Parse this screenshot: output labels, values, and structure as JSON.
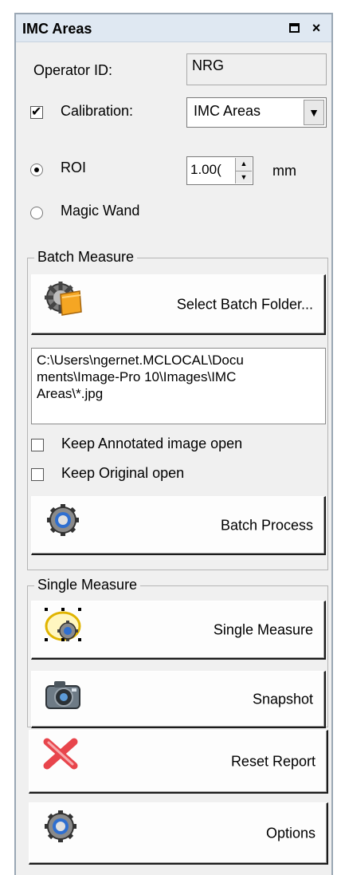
{
  "window": {
    "title": "IMC Areas",
    "maximize_icon": "maximize-icon",
    "close_glyph": "×"
  },
  "operator": {
    "label": "Operator ID:",
    "value": "NRG"
  },
  "calibration": {
    "label": "Calibration:",
    "checked": true,
    "value": "IMC Areas",
    "arrow": "▼"
  },
  "roi": {
    "label": "ROI",
    "selected": true,
    "value": "1.00(",
    "unit": "mm"
  },
  "magic_wand": {
    "label": "Magic Wand",
    "selected": false
  },
  "batch": {
    "group_label": "Batch Measure",
    "select_folder_label": "Select Batch Folder...",
    "path": "C:\\Users\\ngernet.MCLOCAL\\Docu\nments\\Image-Pro 10\\Images\\IMC\nAreas\\*.jpg",
    "keep_annotated_label": "Keep Annotated image open",
    "keep_original_label": "Keep Original open",
    "process_label": "Batch Process"
  },
  "single": {
    "group_label": "Single Measure",
    "measure_label": "Single Measure",
    "snapshot_label": "Snapshot"
  },
  "reset_label": "Reset Report",
  "options_label": "Options",
  "icons": {
    "folder_gear": "folder-gear-icon",
    "gear": "gear-icon",
    "roi_gear": "roi-gear-icon",
    "camera": "camera-icon",
    "red_x": "red-x-icon"
  },
  "colors": {
    "titlebar": "#dfe8f2",
    "panel": "#f0f0f0",
    "reset_red": "#e8454c"
  }
}
